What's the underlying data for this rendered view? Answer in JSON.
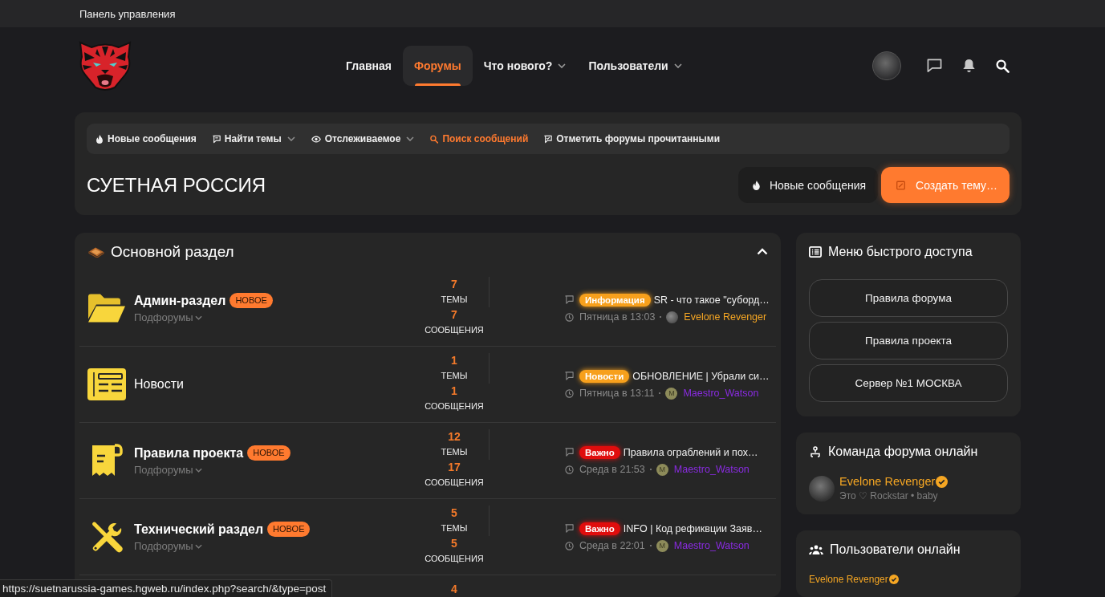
{
  "top_bar": {
    "title": "Панель управления"
  },
  "nav": {
    "items": [
      {
        "label": "Главная",
        "selected": false,
        "dropdown": false
      },
      {
        "label": "Форумы",
        "selected": true,
        "dropdown": false
      },
      {
        "label": "Что нового?",
        "selected": false,
        "dropdown": true
      },
      {
        "label": "Пользователи",
        "selected": false,
        "dropdown": true
      }
    ]
  },
  "toolbar": {
    "items": [
      {
        "label": "Новые сообщения",
        "dropdown": false,
        "highlighted": false
      },
      {
        "label": "Найти темы",
        "dropdown": true,
        "highlighted": false
      },
      {
        "label": "Отслеживаемое",
        "dropdown": true,
        "highlighted": false
      },
      {
        "label": "Поиск сообщений",
        "dropdown": false,
        "highlighted": true
      },
      {
        "label": "Отметить форумы прочитанными",
        "dropdown": false,
        "highlighted": false
      }
    ]
  },
  "page_title": "СУЕТНАЯ РОССИЯ",
  "actions": [
    {
      "label": "Новые сообщения",
      "kind": "secondary"
    },
    {
      "label": "Создать тему…",
      "kind": "primary"
    }
  ],
  "category": {
    "title": "Основной раздел",
    "expanded": true,
    "forums": [
      {
        "title": "Админ-раздел",
        "unread": true,
        "badge": "НОВОЕ",
        "subforums": "Подфорумы",
        "topics": "7",
        "topics_label": "ТЕМЫ",
        "messages": "7",
        "messages_label": "СООБЩЕНИЯ",
        "last_post": {
          "prefix": {
            "label": "Информация",
            "color": "#f7a01c"
          },
          "title": "SR - что такое \"суборд…",
          "date": "Пятница в 13:03",
          "author": {
            "name": "Evelone Revenger",
            "color": "#f5a623",
            "avatar": {
              "kind": "photo"
            }
          }
        }
      },
      {
        "title": "Новости",
        "unread": false,
        "topics": "1",
        "topics_label": "ТЕМЫ",
        "messages": "1",
        "messages_label": "СООБЩЕНИЯ",
        "last_post": {
          "prefix": {
            "label": "Новости",
            "color": "#f7a01c"
          },
          "title": "ОБНОВЛЕНИЕ | Убрали си…",
          "date": "Пятница в 13:11",
          "author": {
            "name": "Maestro_Watson",
            "color": "#8a2be2",
            "avatar": {
              "kind": "letter",
              "letter": "M"
            }
          }
        }
      },
      {
        "title": "Правила проекта",
        "unread": true,
        "badge": "НОВОЕ",
        "subforums": "Подфорумы",
        "topics": "12",
        "topics_label": "ТЕМЫ",
        "messages": "17",
        "messages_label": "СООБЩЕНИЯ",
        "last_post": {
          "prefix": {
            "label": "Важно",
            "color": "#e00d0d"
          },
          "title": "Правила ограблений и пох…",
          "date": "Среда в 21:53",
          "author": {
            "name": "Maestro_Watson",
            "color": "#8a2be2",
            "avatar": {
              "kind": "letter",
              "letter": "M"
            }
          }
        }
      },
      {
        "title": "Технический раздел",
        "unread": true,
        "badge": "НОВОЕ",
        "subforums": "Подфорумы",
        "topics": "5",
        "topics_label": "ТЕМЫ",
        "messages": "5",
        "messages_label": "СООБЩЕНИЯ",
        "last_post": {
          "prefix": {
            "label": "Важно",
            "color": "#e00d0d"
          },
          "title": "INFO | Код рефиквции Заяв…",
          "date": "Среда в 22:01",
          "author": {
            "name": "Maestro_Watson",
            "color": "#8a2be2",
            "avatar": {
              "kind": "letter",
              "letter": "M"
            }
          }
        }
      },
      {
        "topics": "4"
      }
    ]
  },
  "quick_menu": {
    "title": "Меню быстрого доступа",
    "links": [
      "Правила форума",
      "Правила проекта",
      "Сервер №1 МОСКВА"
    ]
  },
  "staff_online": {
    "title": "Команда форума онлайн",
    "members": [
      {
        "name": "Evelone Revenger",
        "verified": true,
        "status": "Это ♡ Rockstar • baby"
      }
    ]
  },
  "users_online": {
    "title": "Пользователи онлайн",
    "users": [
      {
        "name": "Evelone Revenger",
        "verified": true
      }
    ]
  },
  "status_url": "https://suetnarussia-games.hgweb.ru/index.php?search/&type=post"
}
